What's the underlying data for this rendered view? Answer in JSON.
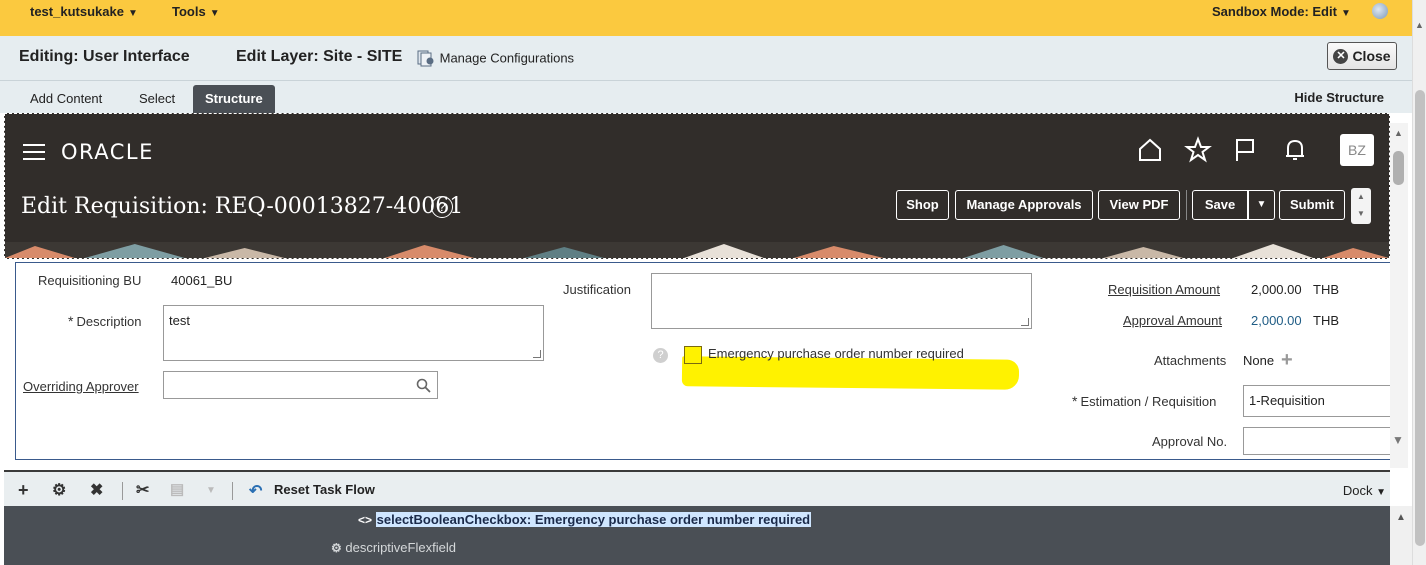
{
  "topbar": {
    "user_menu": "test_kutsukake",
    "tools_menu": "Tools",
    "sandbox_mode": "Sandbox Mode: Edit"
  },
  "editbar": {
    "editing": "Editing: User Interface",
    "edit_layer": "Edit Layer: Site - SITE",
    "manage_configurations": "Manage Configurations",
    "close_label": "Close"
  },
  "tabs": {
    "add_content": "Add Content",
    "select": "Select",
    "structure": "Structure",
    "hide_structure": "Hide Structure"
  },
  "header": {
    "logo": "ORACLE",
    "avatar_initials": "BZ",
    "page_title": "Edit Requisition: REQ-00013827-40061",
    "help": "?",
    "buttons": {
      "shop": "Shop",
      "manage_approvals": "Manage Approvals",
      "view_pdf": "View PDF",
      "save": "Save",
      "submit": "Submit"
    }
  },
  "form": {
    "requisitioning_bu_label": "Requisitioning BU",
    "requisitioning_bu_value": "40061_BU",
    "required_marker": "*",
    "description_label": "Description",
    "description_value": "test",
    "overriding_approver_label": "Overriding Approver",
    "justification_label": "Justification",
    "emergency_checkbox_label": "Emergency purchase order number required",
    "requisition_amount_label": "Requisition Amount",
    "requisition_amount_value": "2,000.00",
    "requisition_amount_currency": "THB",
    "approval_amount_label": "Approval Amount",
    "approval_amount_value": "2,000.00",
    "approval_amount_currency": "THB",
    "attachments_label": "Attachments",
    "attachments_value": "None",
    "estimation_label": "Estimation / Requisition",
    "estimation_value": "1-Requisition",
    "approval_no_label": "Approval No."
  },
  "structure_toolbar": {
    "reset_task_flow": "Reset Task Flow",
    "dock": "Dock"
  },
  "structure_tree": {
    "selected_node": "selectBooleanCheckbox: Emergency purchase order number required",
    "next_node": "descriptiveFlexfield"
  },
  "colors": {
    "topbar": "#fbc93f",
    "header_dark": "#312d2a",
    "highlight": "#fff200",
    "link_blue": "#1f5c85",
    "tree_bg": "#4a4f55",
    "tree_selected": "#cfe6ff"
  }
}
